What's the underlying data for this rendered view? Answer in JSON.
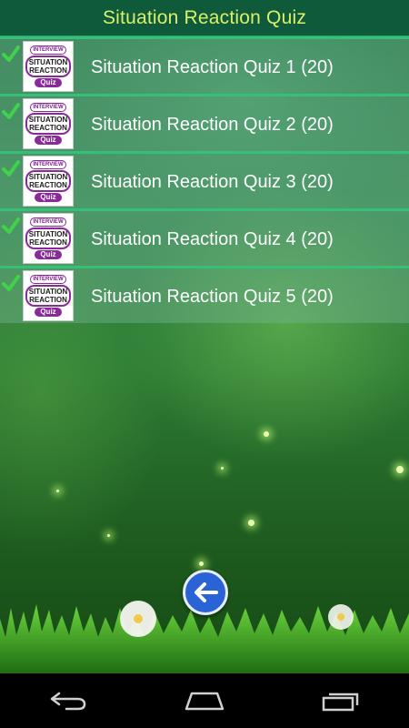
{
  "app": {
    "title": "Situation Reaction Quiz"
  },
  "thumbnail": {
    "top": "INTERVIEW",
    "middle": [
      "SITUATION",
      "REACTION"
    ],
    "bottom": "Quiz"
  },
  "quizzes": [
    {
      "label": "Situation Reaction Quiz 1 (20)",
      "completed": true
    },
    {
      "label": "Situation Reaction Quiz 2 (20)",
      "completed": true
    },
    {
      "label": "Situation Reaction Quiz 3 (20)",
      "completed": true
    },
    {
      "label": "Situation Reaction Quiz 4 (20)",
      "completed": true
    },
    {
      "label": "Situation Reaction Quiz 5 (20)",
      "completed": true
    }
  ],
  "icons": {
    "check": "check-icon",
    "back": "back-arrow-icon",
    "nav_back": "nav-back-icon",
    "nav_home": "nav-home-icon",
    "nav_recents": "nav-recents-icon"
  },
  "colors": {
    "title_text": "#d9f06a",
    "title_bar": "#0f5a3a",
    "row_border": "#35c07a",
    "check": "#3fd24a",
    "back_button": "#2a63d6",
    "thumb_accent": "#8a2a9a"
  }
}
